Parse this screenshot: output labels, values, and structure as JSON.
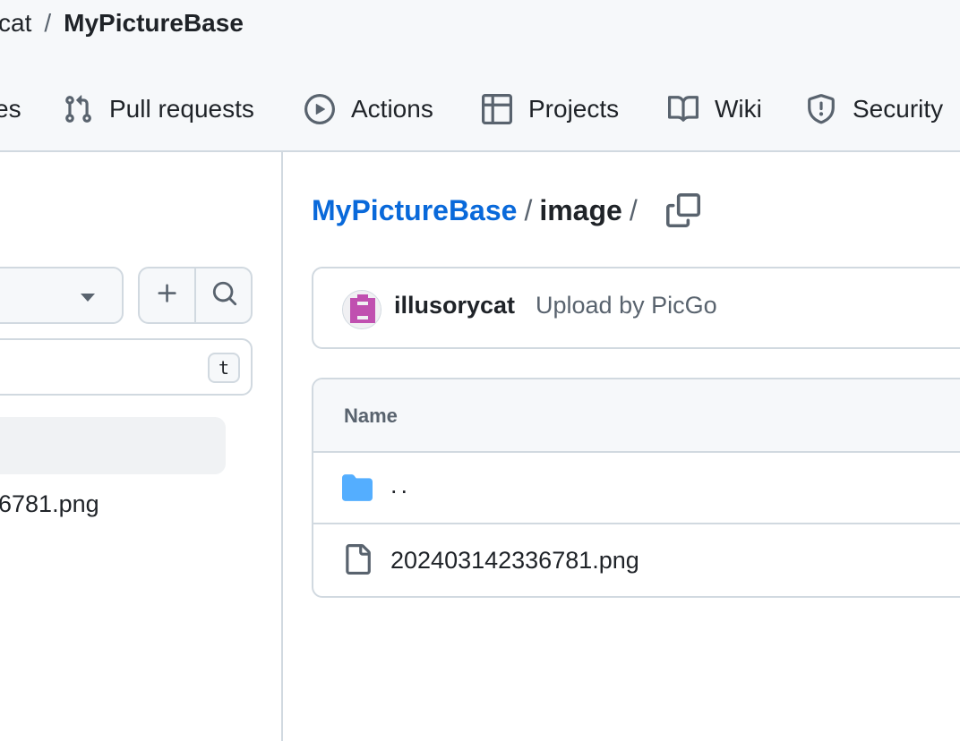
{
  "repo": {
    "owner": "cat",
    "separator": "/",
    "name": "MyPictureBase"
  },
  "tabs": [
    {
      "label": "es",
      "icon": "issues-icon"
    },
    {
      "label": "Pull requests",
      "icon": "pull-request-icon"
    },
    {
      "label": "Actions",
      "icon": "play-icon"
    },
    {
      "label": "Projects",
      "icon": "table-icon"
    },
    {
      "label": "Wiki",
      "icon": "book-icon"
    },
    {
      "label": "Security",
      "icon": "shield-icon"
    }
  ],
  "tree": {
    "filter_shortcut": "t",
    "file_label": "6781.png",
    "add_icon": "plus-icon",
    "search_icon": "search-icon",
    "branch_caret_icon": "caret-down-icon"
  },
  "path": {
    "root": "MyPictureBase",
    "sep1": "/",
    "dir": "image",
    "sep2": "/",
    "copy_icon": "copy-icon"
  },
  "commit": {
    "user": "illusorycat",
    "message": "Upload by PicGo"
  },
  "table": {
    "header_name": "Name",
    "rows": [
      {
        "label": "..",
        "icon": "folder-icon"
      },
      {
        "label": "202403142336781.png",
        "icon": "file-icon"
      }
    ]
  },
  "colors": {
    "link": "#0969da",
    "folder": "#54aeff",
    "avatar": "#c050b0"
  }
}
